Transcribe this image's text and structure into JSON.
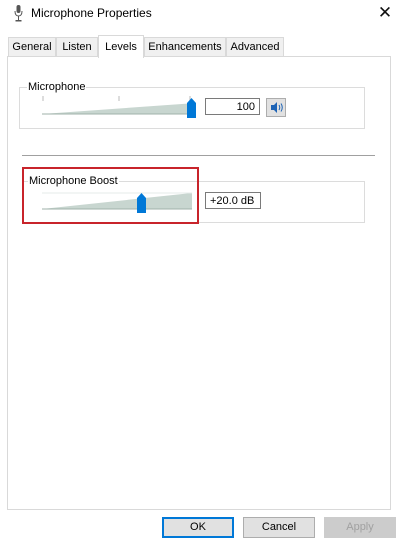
{
  "window": {
    "title": "Microphone Properties",
    "close_glyph": "✕",
    "icon": "microphone-icon"
  },
  "tabs": [
    {
      "label": "General",
      "active": false
    },
    {
      "label": "Listen",
      "active": false
    },
    {
      "label": "Levels",
      "active": true
    },
    {
      "label": "Enhancements",
      "active": false
    },
    {
      "label": "Advanced",
      "active": false
    }
  ],
  "levels": {
    "microphone": {
      "label": "Microphone",
      "value": "100",
      "level_percent": 100,
      "speaker_icon": "speaker-icon"
    },
    "boost": {
      "label": "Microphone Boost",
      "value": "+20.0 dB",
      "level_fraction": 0.67
    }
  },
  "buttons": {
    "ok": "OK",
    "cancel": "Cancel",
    "apply": "Apply"
  },
  "colors": {
    "accent": "#0078d7",
    "highlight": "#c8242b"
  }
}
